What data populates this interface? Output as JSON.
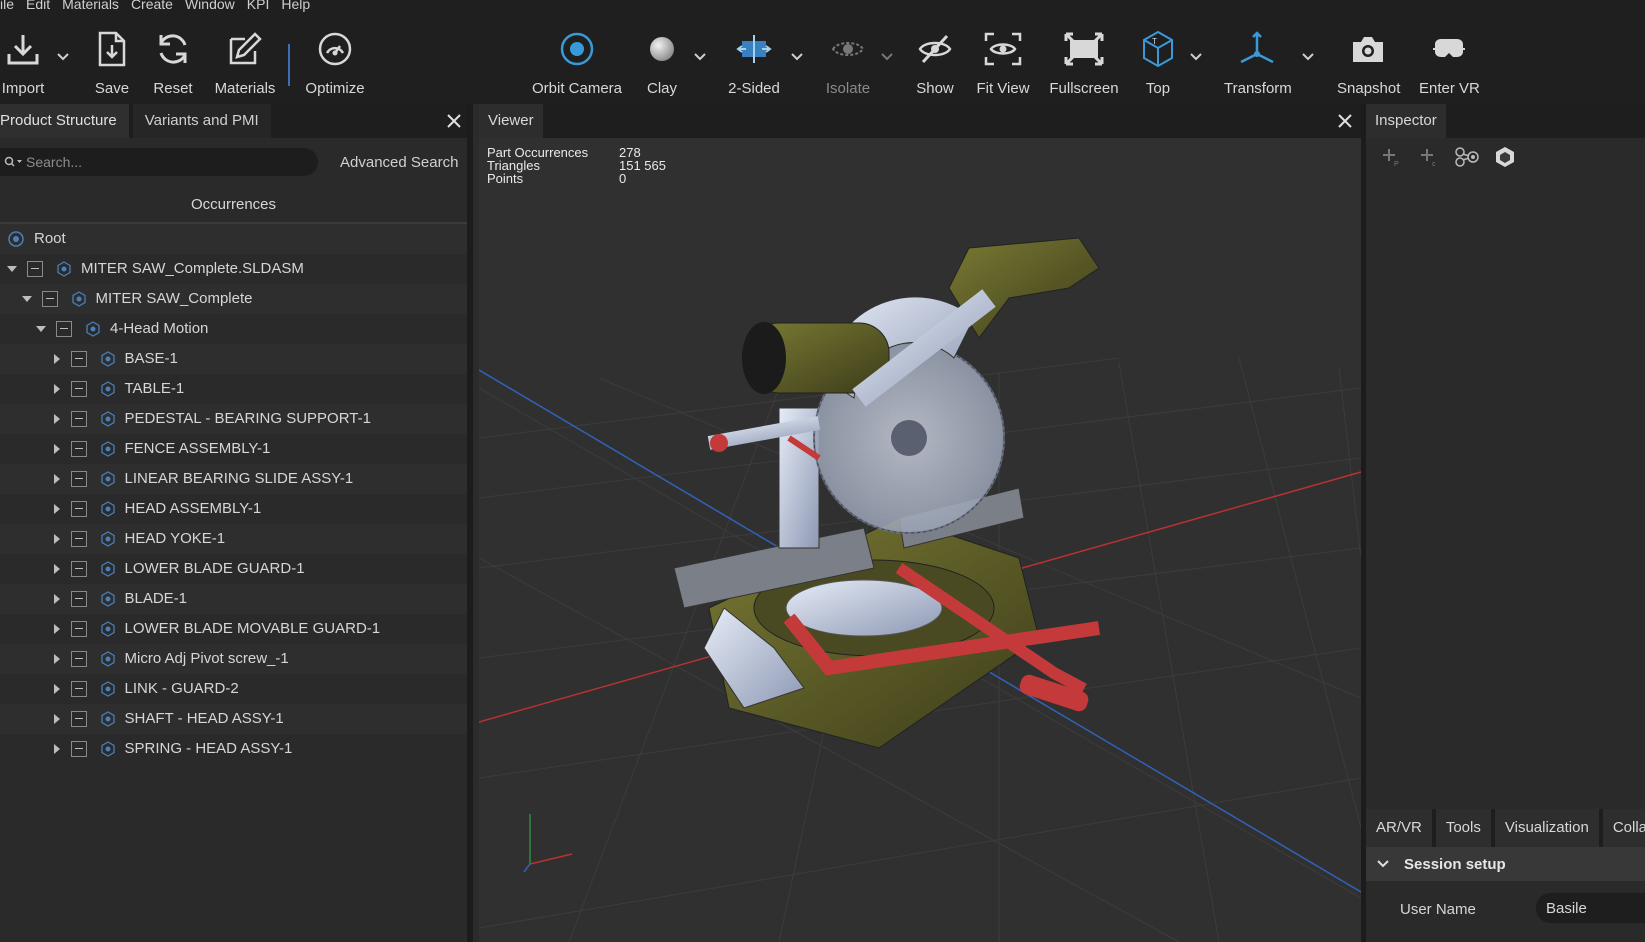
{
  "menu": [
    "ile",
    "Edit",
    "Materials",
    "Create",
    "Window",
    "KPI",
    "Help"
  ],
  "toolbar": {
    "import": "Import",
    "save": "Save",
    "reset": "Reset",
    "materials": "Materials",
    "optimize": "Optimize",
    "orbit_camera": "Orbit Camera",
    "clay": "Clay",
    "two_sided": "2-Sided",
    "isolate": "Isolate",
    "show": "Show",
    "fit_view": "Fit View",
    "fullscreen": "Fullscreen",
    "top": "Top",
    "transform": "Transform",
    "snapshot": "Snapshot",
    "enter_vr": "Enter VR",
    "accent": "#3a9ad9"
  },
  "left_panel": {
    "tabs": [
      "Product Structure",
      "Variants and PMI"
    ],
    "search_placeholder": "Search...",
    "advanced_search": "Advanced Search",
    "occurrences_header": "Occurrences",
    "root": "Root",
    "tree": [
      "MITER SAW_Complete.SLDASM",
      "MITER SAW_Complete",
      "4-Head Motion",
      "BASE-1",
      "TABLE-1",
      "PEDESTAL - BEARING SUPPORT-1",
      "FENCE ASSEMBLY-1",
      "LINEAR BEARING SLIDE ASSY-1",
      "HEAD ASSEMBLY-1",
      "HEAD YOKE-1",
      "LOWER BLADE GUARD-1",
      "BLADE-1",
      "LOWER BLADE MOVABLE GUARD-1",
      "Micro Adj Pivot screw_-1",
      "LINK - GUARD-2",
      "SHAFT - HEAD ASSY-1",
      "SPRING - HEAD ASSY-1"
    ]
  },
  "viewer": {
    "tab": "Viewer",
    "stats": {
      "part_occurrences_label": "Part Occurrences",
      "part_occurrences": "278",
      "triangles_label": "Triangles",
      "triangles": "151 565",
      "points_label": "Points",
      "points": "0"
    }
  },
  "inspector": {
    "tab": "Inspector",
    "bottom_tabs": [
      "AR/VR",
      "Tools",
      "Visualization",
      "Colla"
    ],
    "session_setup": "Session setup",
    "user_name_label": "User Name",
    "user_name_value": "Basile"
  }
}
